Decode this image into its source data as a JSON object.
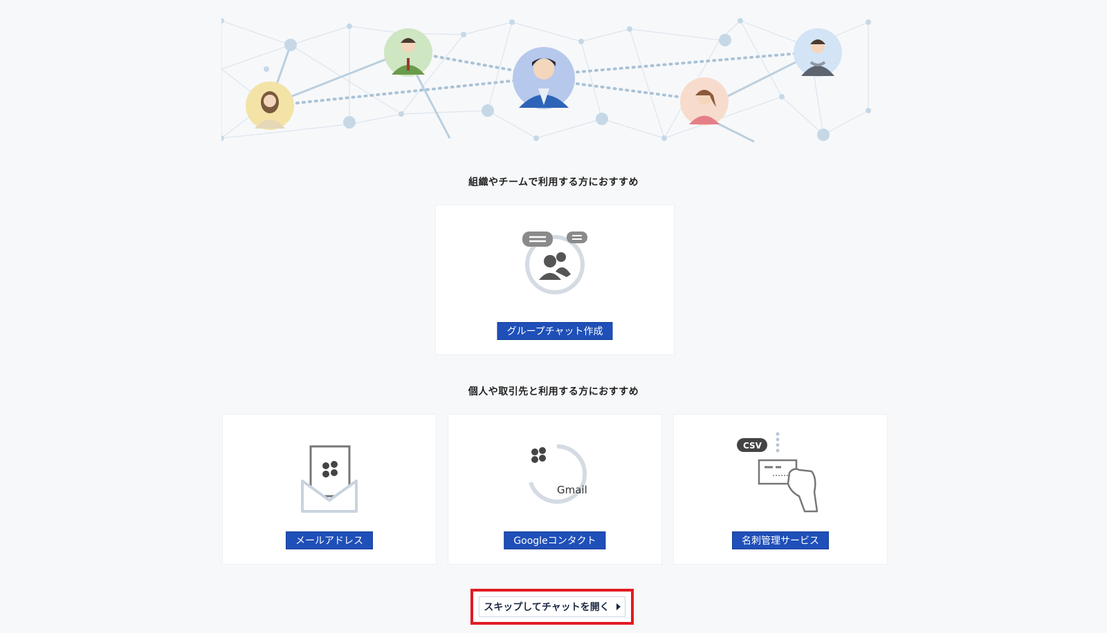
{
  "sections": {
    "org_title": "組織やチームで利用する方におすすめ",
    "personal_title": "個人や取引先と利用する方におすすめ"
  },
  "buttons": {
    "group_chat": "グループチャット作成",
    "email": "メールアドレス",
    "google_contacts": "Googleコンタクト",
    "business_card": "名刺管理サービス",
    "skip": "スキップしてチャットを開く"
  },
  "illustrations": {
    "gmail_label": "Gmail",
    "csv_label": "CSV"
  },
  "icons": {
    "hero": "network-people-illustration",
    "group": "group-chat-icon",
    "email": "mail-envelope-icon",
    "google": "google-contacts-icon",
    "card": "business-card-csv-icon",
    "skip_arrow": "triangle-right-icon"
  },
  "colors": {
    "button_blue": "#1f4fb8",
    "highlight_red": "#e21a22",
    "network_line": "#c8d7e3",
    "icon_gray": "#5a5a5a"
  }
}
